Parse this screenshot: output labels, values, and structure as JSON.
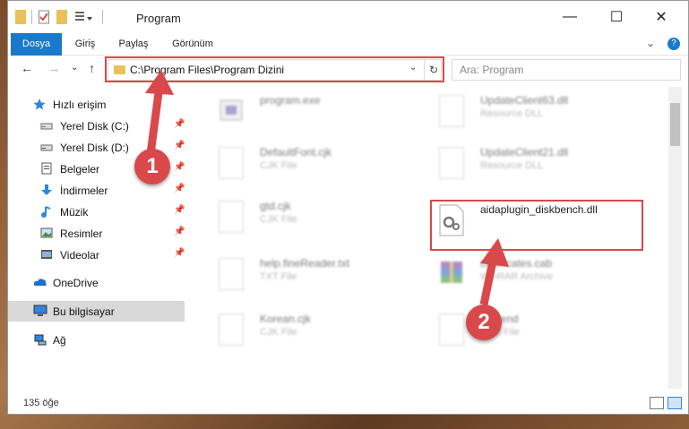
{
  "window": {
    "title": "Program"
  },
  "titlebar": {
    "minimize": "—",
    "maximize": "☐",
    "close": "✕"
  },
  "ribbon": {
    "tabs": [
      {
        "label": "Dosya"
      },
      {
        "label": "Giriş"
      },
      {
        "label": "Paylaş"
      },
      {
        "label": "Görünüm"
      }
    ],
    "expand": "⌄",
    "help": "?"
  },
  "nav": {
    "back": "←",
    "forward": "→",
    "recent": "⌄",
    "up": "↑",
    "address": "C:\\Program Files\\Program Dizini",
    "dropdown": "⌄",
    "refresh": "↻",
    "search_placeholder": "Ara: Program"
  },
  "sidebar": {
    "items": [
      {
        "label": "Hızlı erişim",
        "icon": "star-icon"
      },
      {
        "label": "Yerel Disk (C:)",
        "icon": "drive-icon",
        "pinned": "📌"
      },
      {
        "label": "Yerel Disk (D:)",
        "icon": "drive-icon",
        "pinned": "📌"
      },
      {
        "label": "Belgeler",
        "icon": "documents-icon",
        "pinned": "📌"
      },
      {
        "label": "İndirmeler",
        "icon": "download-icon",
        "pinned": "📌"
      },
      {
        "label": "Müzik",
        "icon": "music-icon",
        "pinned": "📌"
      },
      {
        "label": "Resimler",
        "icon": "pictures-icon",
        "pinned": "📌"
      },
      {
        "label": "Videolar",
        "icon": "videos-icon",
        "pinned": "📌"
      },
      {
        "label": "OneDrive",
        "icon": "cloud-icon"
      },
      {
        "label": "Bu bilgisayar",
        "icon": "computer-icon"
      },
      {
        "label": "Ağ",
        "icon": "network-icon"
      }
    ]
  },
  "files": [
    {
      "name": "program.exe",
      "type": ""
    },
    {
      "name": "UpdateClient63.dll",
      "type": "Resource DLL"
    },
    {
      "name": "DefaultFont.cjk",
      "type": "CJK File"
    },
    {
      "name": "UpdateClient21.dll",
      "type": "Resource DLL"
    },
    {
      "name": "gtd.cjk",
      "type": "CJK File"
    },
    {
      "name": "aidaplugin_diskbench.dll",
      "type": ""
    },
    {
      "name": "help.fineReader.txt",
      "type": "TXT File"
    },
    {
      "name": "certificates.cab",
      "type": "WinRAR Archive"
    },
    {
      "name": "Korean.cjk",
      "type": "CJK File"
    },
    {
      "name": "resi.end",
      "type": "END File"
    }
  ],
  "status": {
    "count": "135 öğe"
  },
  "annotations": {
    "step1": "1",
    "step2": "2"
  },
  "colors": {
    "accent": "#1979ca",
    "highlight": "#d94848",
    "selection": "#d9d9d9"
  }
}
